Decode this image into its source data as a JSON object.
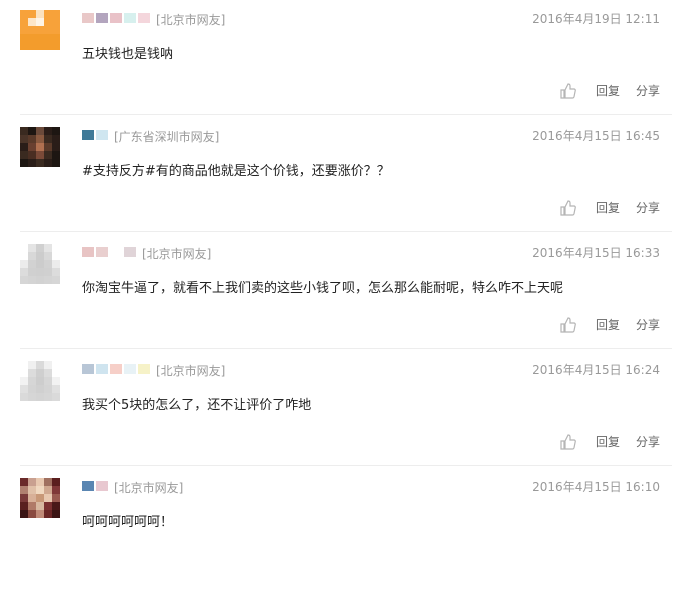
{
  "comments": [
    {
      "location": "[北京市网友]",
      "time": "2016年4月19日 12:11",
      "text": "五块钱也是钱呐",
      "reply_label": "回复",
      "share_label": "分享",
      "avatar_colors": [
        "#f7a23a",
        "#f7a23a",
        "#fbe2c0",
        "#f7a23a",
        "#f7a23a",
        "#f7a23a",
        "#fde6c8",
        "#fef4e6",
        "#f7a23a",
        "#f7a23a",
        "#f7a23a",
        "#f7a23a",
        "#f7a23a",
        "#f7a23a",
        "#f7a23a",
        "#f39c2c",
        "#f39c2c",
        "#f39c2c",
        "#f39c2c",
        "#f39c2c",
        "#f39c2c",
        "#f39c2c",
        "#f39c2c",
        "#f39c2c",
        "#f39c2c"
      ],
      "nick_colors": [
        "#e9c8c8",
        "#b3a5be",
        "#e9c2c8",
        "#d7f0ee",
        "#f4d6dc"
      ]
    },
    {
      "location": "[广东省深圳市网友]",
      "time": "2016年4月15日 16:45",
      "text": "#支持反方#有的商品他就是这个价钱，还要涨价？？",
      "reply_label": "回复",
      "share_label": "分享",
      "avatar_colors": [
        "#3a2a20",
        "#1d1612",
        "#6b4a3a",
        "#2a1d18",
        "#1d1612",
        "#4a3428",
        "#5a3a2a",
        "#8a5a40",
        "#3a2a20",
        "#2a1d18",
        "#2a1d18",
        "#6a4030",
        "#b07050",
        "#5a3a2a",
        "#2a1d18",
        "#3a2a20",
        "#4a2e22",
        "#7a4a38",
        "#3a2a20",
        "#1d1612",
        "#1d1612",
        "#2a1d18",
        "#3a2a20",
        "#2a1d18",
        "#1d1612"
      ],
      "nick_colors": [
        "#3f7a98",
        "#cfe6f0"
      ]
    },
    {
      "location": "[北京市网友]",
      "time": "2016年4月15日 16:33",
      "text": "你淘宝牛逼了，就看不上我们卖的这些小钱了呗，怎么那么能耐呢，特么咋不上天呢",
      "reply_label": "回复",
      "share_label": "分享",
      "avatar_colors": [
        "#ffffff",
        "#e4e4e4",
        "#d0d0d0",
        "#e4e4e4",
        "#ffffff",
        "#ffffff",
        "#d8d8d8",
        "#cccccc",
        "#d8d8d8",
        "#ffffff",
        "#ececec",
        "#d2d2d2",
        "#cccccc",
        "#d2d2d2",
        "#ececec",
        "#dcdcdc",
        "#d0d0d0",
        "#cfcfcf",
        "#d0d0d0",
        "#dcdcdc",
        "#d6d6d6",
        "#d4d4d4",
        "#d2d2d2",
        "#d4d4d4",
        "#d6d6d6"
      ],
      "nick_colors": [
        "#e8c4c4",
        "#e9cfcf",
        "#ffffff",
        "#e0d4d8"
      ]
    },
    {
      "location": "[北京市网友]",
      "time": "2016年4月15日 16:24",
      "text": "我买个5块的怎么了，还不让评价了咋地",
      "reply_label": "回复",
      "share_label": "分享",
      "avatar_colors": [
        "#ffffff",
        "#f0f0f0",
        "#dadada",
        "#f0f0f0",
        "#ffffff",
        "#ffffff",
        "#dcdcdc",
        "#cfcfcf",
        "#dcdcdc",
        "#ffffff",
        "#f2f2f2",
        "#d6d6d6",
        "#cdcdcd",
        "#d6d6d6",
        "#f2f2f2",
        "#e0e0e0",
        "#d4d4d4",
        "#d0d0d0",
        "#d4d4d4",
        "#e0e0e0",
        "#dadada",
        "#d6d6d6",
        "#d4d4d4",
        "#d6d6d6",
        "#dadada"
      ],
      "nick_colors": [
        "#b8c6d6",
        "#cfe4ef",
        "#f6cfc8",
        "#e8f2f6",
        "#f6f2c8"
      ]
    },
    {
      "location": "[北京市网友]",
      "time": "2016年4月15日 16:10",
      "text": "呵呵呵呵呵呵！",
      "reply_label": "回复",
      "share_label": "分享",
      "avatar_colors": [
        "#6a2a2a",
        "#c9a090",
        "#e8c8b0",
        "#a07060",
        "#5a1e1e",
        "#b08070",
        "#e0c0a8",
        "#f0d8c0",
        "#d0a890",
        "#803838",
        "#7a3a3a",
        "#d8b098",
        "#c89878",
        "#e8c8b0",
        "#9a5a50",
        "#5a2020",
        "#b07a68",
        "#d8b8a0",
        "#7a3030",
        "#4a1818",
        "#3a1414",
        "#8a4a40",
        "#c08a78",
        "#6a2626",
        "#3a1414"
      ],
      "nick_colors": [
        "#5a86b2",
        "#e8c8d0"
      ]
    }
  ]
}
